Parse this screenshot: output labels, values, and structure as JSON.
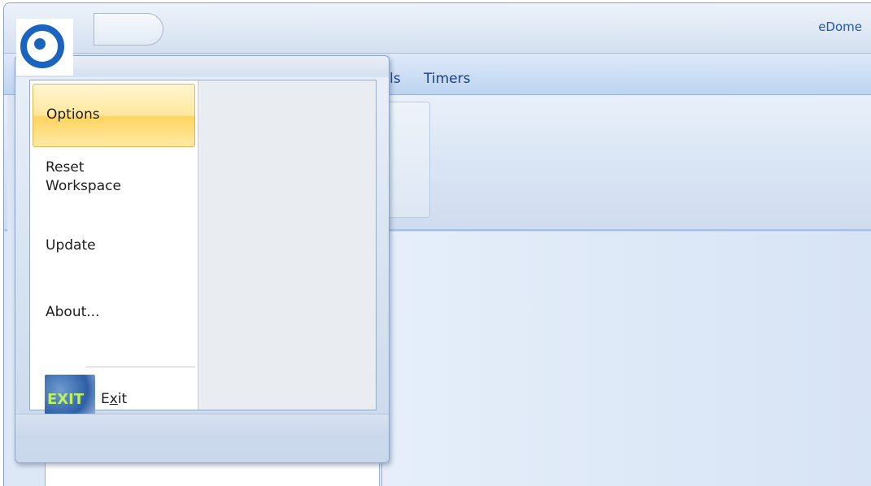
{
  "app": {
    "title": "eDome"
  },
  "ribbon": {
    "tabs": [
      {
        "label": "ls"
      },
      {
        "label": "Timers"
      }
    ]
  },
  "app_menu": {
    "items": [
      {
        "label": "Options",
        "selected": true
      },
      {
        "label": "Reset\nWorkspace"
      },
      {
        "label": "Update"
      },
      {
        "label": "About..."
      }
    ],
    "exit": {
      "icon_text": "EXIT",
      "label_prefix": "E",
      "label_mnemonic": "x",
      "label_suffix": "it"
    }
  },
  "colors": {
    "accent": "#1a64c0",
    "selected_item": "#ffd460",
    "ribbon_text": "#15428b"
  },
  "icons": {
    "app_orb": "app-logo-icon",
    "exit": "exit-icon"
  }
}
